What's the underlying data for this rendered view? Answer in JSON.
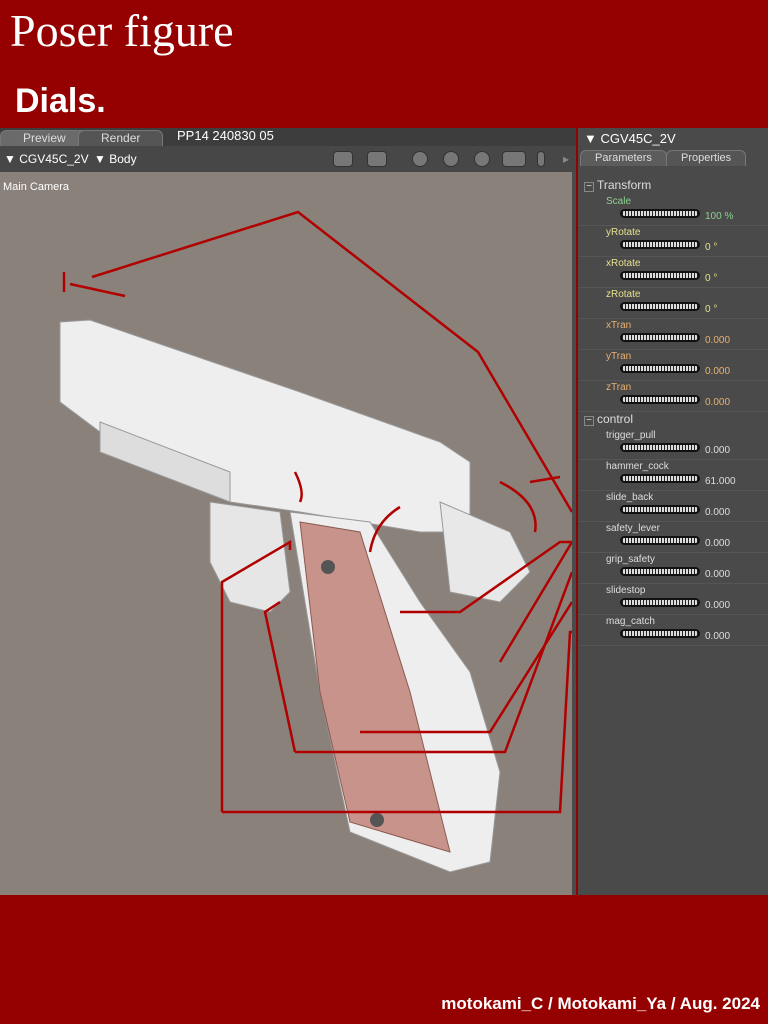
{
  "header": {
    "title": "Poser figure",
    "subtitle": "Dials."
  },
  "preview": {
    "tabs": [
      "Preview",
      "Render"
    ],
    "document": "PP14  240830  05",
    "figure_select": "CGV45C_2V",
    "part_select": "Body",
    "camera": "Main Camera"
  },
  "params_panel": {
    "figure": "CGV45C_2V",
    "tabs": [
      "Parameters",
      "Properties"
    ],
    "groups": [
      {
        "name": "Transform",
        "params": [
          {
            "name": "Scale",
            "value": "100 %",
            "color": "#8fd08f"
          },
          {
            "name": "yRotate",
            "value": "0 °",
            "color": "#e6e08a"
          },
          {
            "name": "xRotate",
            "value": "0 °",
            "color": "#e6e08a"
          },
          {
            "name": "zRotate",
            "value": "0 °",
            "color": "#e6e08a"
          },
          {
            "name": "xTran",
            "value": "0.000",
            "color": "#e8b070"
          },
          {
            "name": "yTran",
            "value": "0.000",
            "color": "#e8b070"
          },
          {
            "name": "zTran",
            "value": "0.000",
            "color": "#e8b070"
          }
        ]
      },
      {
        "name": "control",
        "params": [
          {
            "name": "trigger_pull",
            "value": "0.000",
            "color": "#dddddd"
          },
          {
            "name": "hammer_cock",
            "value": "61.000",
            "color": "#dddddd"
          },
          {
            "name": "slide_back",
            "value": "0.000",
            "color": "#dddddd"
          },
          {
            "name": "safety_lever",
            "value": "0.000",
            "color": "#dddddd"
          },
          {
            "name": "grip_safety",
            "value": "0.000",
            "color": "#dddddd"
          },
          {
            "name": "slidestop",
            "value": "0.000",
            "color": "#dddddd"
          },
          {
            "name": "mag_catch",
            "value": "0.000",
            "color": "#dddddd"
          }
        ]
      }
    ]
  },
  "footer": {
    "credit": "motokami_C / Motokami_Ya / Aug. 2024"
  }
}
